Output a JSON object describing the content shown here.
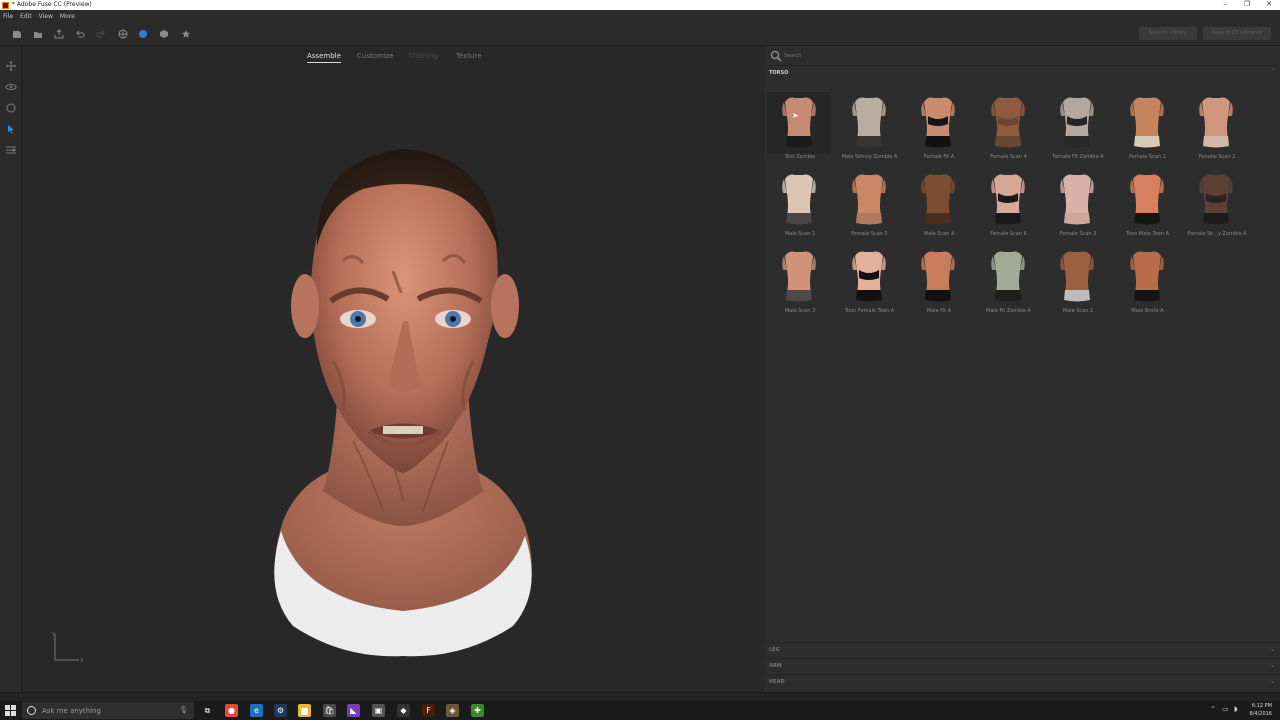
{
  "window": {
    "title": "* Adobe Fuse CC (Preview)",
    "controls": [
      "–",
      "❐",
      "✕"
    ]
  },
  "menu": [
    "File",
    "Edit",
    "View",
    "More"
  ],
  "toolbar": {
    "icons": [
      "new-icon",
      "open-icon",
      "export-icon",
      "undo-icon",
      "redo-icon",
      "globe-icon",
      "sphere-icon",
      "cube-icon",
      "star-icon"
    ],
    "buttons": [
      "Save to Library",
      "Save to CC Libraries"
    ]
  },
  "left_tools": [
    "pan-icon",
    "orbit-icon",
    "rotate-icon",
    "select-icon",
    "adjust-icon"
  ],
  "tabs": [
    {
      "label": "Assemble",
      "state": "active"
    },
    {
      "label": "Customize",
      "state": "normal"
    },
    {
      "label": "Clothing",
      "state": "disabled"
    },
    {
      "label": "Texture",
      "state": "normal"
    }
  ],
  "axis": {
    "y": "Y",
    "x": "X"
  },
  "search": {
    "placeholder": "Search"
  },
  "category": "TORSO",
  "items": [
    {
      "label": "Test Zombie",
      "skin": "#c98a74",
      "bottom": "#1b1b1b",
      "top": "",
      "selected": true
    },
    {
      "label": "Male Skinny Zombie A",
      "skin": "#b8ada0",
      "bottom": "#3a3530",
      "top": ""
    },
    {
      "label": "Female Fit A",
      "skin": "#c98b6e",
      "bottom": "#111111",
      "top": "#151515"
    },
    {
      "label": "Female Scan 4",
      "skin": "#8e5b3e",
      "bottom": "#6b4632",
      "top": "#6e4733"
    },
    {
      "label": "Female Fit Zombie A",
      "skin": "#b2a89d",
      "bottom": "#282828",
      "top": "#252525"
    },
    {
      "label": "Female Scan 1",
      "skin": "#c6835e",
      "bottom": "#d8c9b8",
      "top": ""
    },
    {
      "label": "Female Scan 2",
      "skin": "#d0977f",
      "bottom": "#d5b7a8",
      "top": ""
    },
    {
      "label": "Male Scan 1",
      "skin": "#ddc5b5",
      "bottom": "#4a4542",
      "top": ""
    },
    {
      "label": "Female Scan 5",
      "skin": "#c98766",
      "bottom": "#b07a5e",
      "top": ""
    },
    {
      "label": "Male Scan 4",
      "skin": "#7e4c30",
      "bottom": "#4b2d1e",
      "top": ""
    },
    {
      "label": "Female Scan 6",
      "skin": "#d6a896",
      "bottom": "#1a1a1a",
      "top": "#1b1b1b"
    },
    {
      "label": "Female Scan 3",
      "skin": "#d8b2a6",
      "bottom": "#cfa79a",
      "top": ""
    },
    {
      "label": "Toon Male Teen A",
      "skin": "#d7805f",
      "bottom": "#151515",
      "top": ""
    },
    {
      "label": "Female Sk...y Zombie A",
      "skin": "#5b4035",
      "bottom": "#1c1c1c",
      "top": "#2a2120"
    },
    {
      "label": "Male Scan 3",
      "skin": "#d0927a",
      "bottom": "#4e4944",
      "top": ""
    },
    {
      "label": "Toon Female Teen A",
      "skin": "#e2b09b",
      "bottom": "#121212",
      "top": "#121212"
    },
    {
      "label": "Male Fit A",
      "skin": "#c87c5c",
      "bottom": "#111111",
      "top": ""
    },
    {
      "label": "Male Fit Zombie A",
      "skin": "#a3aa98",
      "bottom": "#1e1e1e",
      "top": ""
    },
    {
      "label": "Male Scan 2",
      "skin": "#9b6040",
      "bottom": "#bcbcbc",
      "top": ""
    },
    {
      "label": "Male Brute A",
      "skin": "#b86c4c",
      "bottom": "#141414",
      "top": ""
    }
  ],
  "sections": [
    {
      "label": "LEG"
    },
    {
      "label": "ARM"
    },
    {
      "label": "HEAD"
    }
  ],
  "taskbar": {
    "search_placeholder": "Ask me anything",
    "apps": [
      {
        "name": "task-view-icon",
        "color": "#1b1b1b",
        "glyph": "⧉"
      },
      {
        "name": "chrome-icon",
        "color": "#e04b3a",
        "glyph": "●"
      },
      {
        "name": "edge-icon",
        "color": "#1c6fc7",
        "glyph": "e"
      },
      {
        "name": "steam-icon",
        "color": "#1e3a5a",
        "glyph": "⚙"
      },
      {
        "name": "explorer-icon",
        "color": "#e8b830",
        "glyph": "▆"
      },
      {
        "name": "store-icon",
        "color": "#4a4a4a",
        "glyph": "🛍"
      },
      {
        "name": "visual-studio-icon",
        "color": "#7a3fb3",
        "glyph": "◣"
      },
      {
        "name": "camera-icon",
        "color": "#555555",
        "glyph": "▣"
      },
      {
        "name": "unity-icon",
        "color": "#333333",
        "glyph": "◆"
      },
      {
        "name": "fuse-icon",
        "color": "#4a1d0d",
        "glyph": "F"
      },
      {
        "name": "cube-app-icon",
        "color": "#6b5a3a",
        "glyph": "◈"
      },
      {
        "name": "green-app-icon",
        "color": "#3a8a2a",
        "glyph": "✚"
      }
    ],
    "time": "6:12 PM",
    "date": "8/4/2016"
  }
}
